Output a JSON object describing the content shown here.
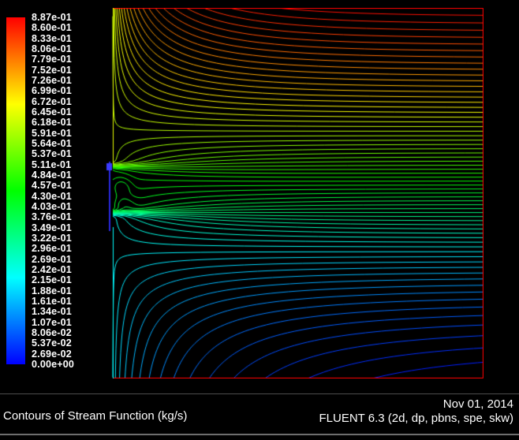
{
  "window": {
    "background": "#000000"
  },
  "legend": {
    "labels": [
      "8.87e-01",
      "8.60e-01",
      "8.33e-01",
      "8.06e-01",
      "7.79e-01",
      "7.52e-01",
      "7.26e-01",
      "6.99e-01",
      "6.72e-01",
      "6.45e-01",
      "6.18e-01",
      "5.91e-01",
      "5.64e-01",
      "5.37e-01",
      "5.11e-01",
      "4.84e-01",
      "4.57e-01",
      "4.30e-01",
      "4.03e-01",
      "3.76e-01",
      "3.49e-01",
      "3.22e-01",
      "2.96e-01",
      "2.69e-01",
      "2.42e-01",
      "2.15e-01",
      "1.88e-01",
      "1.61e-01",
      "1.34e-01",
      "1.07e-01",
      "8.06e-02",
      "5.37e-02",
      "2.69e-02",
      "0.00e+00"
    ]
  },
  "footer": {
    "title": "Contours of Stream Function (kg/s)",
    "date": "Nov 01, 2014",
    "solver": "FLUENT 6.3 (2d, dp, pbns, spe, skw)"
  },
  "chart_data": {
    "type": "contour",
    "title": "Contours of Stream Function (kg/s)",
    "quantity": "Stream Function",
    "units": "kg/s",
    "value_min": 0.0,
    "value_max": 0.887,
    "legend_levels": [
      0.887,
      0.8601,
      0.8332,
      0.8064,
      0.7795,
      0.7526,
      0.7257,
      0.6988,
      0.672,
      0.6451,
      0.6182,
      0.5913,
      0.5645,
      0.5376,
      0.5107,
      0.4838,
      0.4569,
      0.4301,
      0.4032,
      0.3763,
      0.3494,
      0.3226,
      0.2957,
      0.2688,
      0.2419,
      0.215,
      0.1882,
      0.1613,
      0.1344,
      0.1075,
      0.0806,
      0.0537,
      0.0269,
      0.0
    ],
    "n_contour_lines": 66,
    "colormap_low_to_high": [
      "#0000ff",
      "#00ffff",
      "#00ff00",
      "#ffff00",
      "#ff0000"
    ],
    "outline_color": "#ff0000",
    "background": "#000000",
    "legend_position": "left",
    "grid_visible": false,
    "field_model": {
      "grid": 235,
      "base_level": 0.22,
      "tilt": 0.01,
      "upper_jet": {
        "y": 0.573,
        "amp": 0.16,
        "width0": 0.006,
        "spread": 0.055
      },
      "lower_jet": {
        "y": 0.447,
        "amp": 0.22,
        "width0": 0.006,
        "spread": 0.055
      },
      "mix_lambda_top": 0.1,
      "mix_lambda_bottom": 0.26,
      "mix_exponent": 0.75,
      "right_profile_density": {
        "base": 0.32,
        "mid_amp": 1.9,
        "mid_y": 0.5,
        "mid_sigma": 0.24,
        "top_amp": 0.55,
        "top_y": 0.95,
        "top_sigma": 0.18
      },
      "recirculation_dips": [
        {
          "u": 0.022,
          "y": 0.517,
          "depth": 0.03,
          "su": 0.02,
          "sy": 0.02
        },
        {
          "u": 0.028,
          "y": 0.468,
          "depth": 0.028,
          "su": 0.022,
          "sy": 0.016
        }
      ]
    }
  }
}
